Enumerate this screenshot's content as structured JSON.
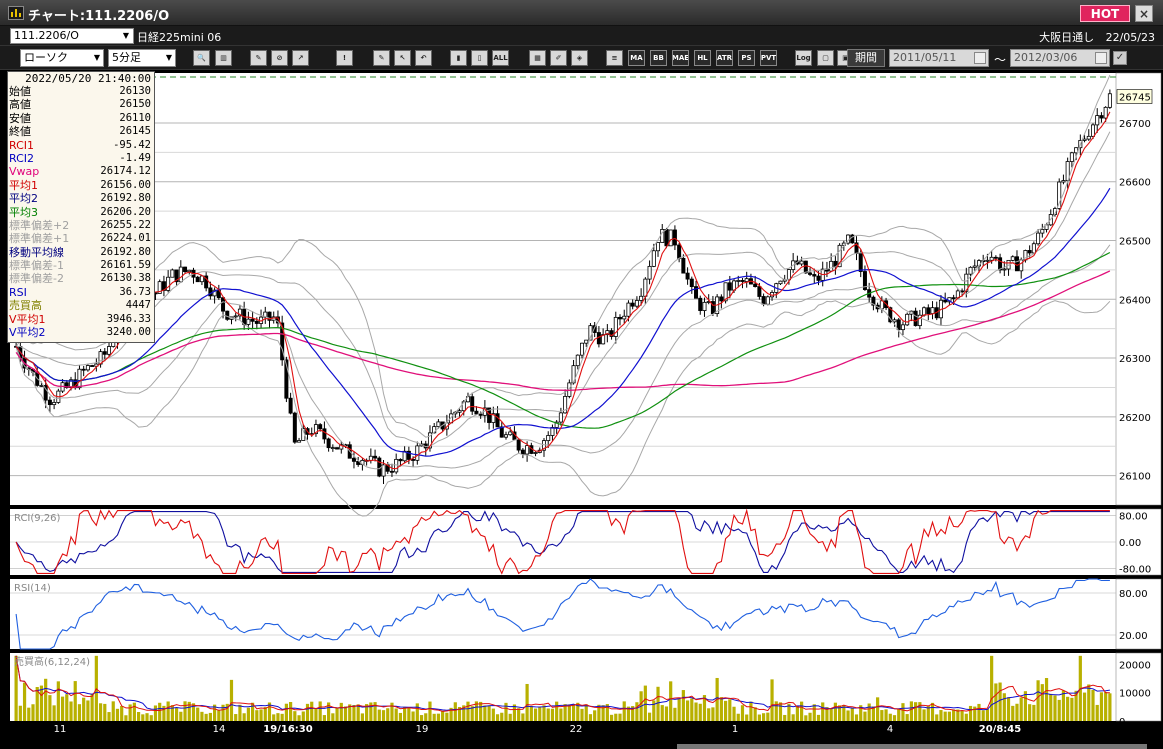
{
  "window": {
    "title": "チャート:111.2206/O",
    "hot_label": "HOT",
    "close_label": "×"
  },
  "symbol_bar": {
    "code": "111.2206/O",
    "name": "日経225mini 06",
    "exchange": "大阪日通し",
    "date": "22/05/23"
  },
  "toolbar": {
    "chart_type": "ローソク",
    "interval": "5分足",
    "period_label": "期間",
    "date_from": "2011/05/11",
    "date_sep": "〜",
    "date_to": "2012/03/06",
    "icons": [
      {
        "name": "magnify-icon",
        "glyph": "🔍"
      },
      {
        "name": "split-icon",
        "glyph": "▥"
      },
      {
        "name": "draw1-icon",
        "glyph": "✎"
      },
      {
        "name": "draw2-icon",
        "glyph": "⊘"
      },
      {
        "name": "draw3-icon",
        "glyph": "↗"
      },
      {
        "name": "alert-icon",
        "glyph": "!"
      },
      {
        "name": "pen-icon",
        "glyph": "✎"
      },
      {
        "name": "cursor-icon",
        "glyph": "↖"
      },
      {
        "name": "undo-icon",
        "glyph": "↶"
      },
      {
        "name": "candle1-icon",
        "glyph": "▮"
      },
      {
        "name": "candle2-icon",
        "glyph": "▯"
      },
      {
        "name": "all-icon",
        "glyph": "ALL"
      },
      {
        "name": "grid-icon",
        "glyph": "▦"
      },
      {
        "name": "brush-icon",
        "glyph": "✐"
      },
      {
        "name": "palette-icon",
        "glyph": "◈"
      },
      {
        "name": "indicator-icon",
        "glyph": "≡"
      },
      {
        "name": "ma-icon",
        "glyph": "MA"
      },
      {
        "name": "bb-icon",
        "glyph": "BB"
      },
      {
        "name": "mae-icon",
        "glyph": "MAE"
      },
      {
        "name": "hl-icon",
        "glyph": "HL"
      },
      {
        "name": "atr-icon",
        "glyph": "ATR"
      },
      {
        "name": "psar-icon",
        "glyph": "PS"
      },
      {
        "name": "pvt-icon",
        "glyph": "PVT"
      },
      {
        "name": "log-icon",
        "glyph": "Log"
      },
      {
        "name": "frame-icon",
        "glyph": "▢"
      },
      {
        "name": "export-icon",
        "glyph": "▣"
      }
    ]
  },
  "info_panel": {
    "timestamp": "2022/05/20 21:40:00",
    "rows": [
      {
        "label": "始値",
        "value": "26130",
        "color": "#000000"
      },
      {
        "label": "高値",
        "value": "26150",
        "color": "#000000"
      },
      {
        "label": "安値",
        "value": "26110",
        "color": "#000000"
      },
      {
        "label": "終値",
        "value": "26145",
        "color": "#000000"
      },
      {
        "label": "RCI1",
        "value": "-95.42",
        "color": "#d00000"
      },
      {
        "label": "RCI2",
        "value": "-1.49",
        "color": "#0000c0"
      },
      {
        "label": "Vwap",
        "value": "26174.12",
        "color": "#e0007a"
      },
      {
        "label": "平均1",
        "value": "26156.00",
        "color": "#d00000"
      },
      {
        "label": "平均2",
        "value": "26192.80",
        "color": "#000080"
      },
      {
        "label": "平均3",
        "value": "26206.20",
        "color": "#008000"
      },
      {
        "label": "標準偏差+2",
        "value": "26255.22",
        "color": "#a0a0a0"
      },
      {
        "label": "標準偏差+1",
        "value": "26224.01",
        "color": "#a0a0a0"
      },
      {
        "label": "移動平均線",
        "value": "26192.80",
        "color": "#000080"
      },
      {
        "label": "標準偏差-1",
        "value": "26161.59",
        "color": "#a0a0a0"
      },
      {
        "label": "標準偏差-2",
        "value": "26130.38",
        "color": "#a0a0a0"
      },
      {
        "label": "RSI",
        "value": "36.73",
        "color": "#0000c0"
      },
      {
        "label": "売買高",
        "value": "4447",
        "color": "#808000"
      },
      {
        "label": "V平均1",
        "value": "3946.33",
        "color": "#d00000"
      },
      {
        "label": "V平均2",
        "value": "3240.00",
        "color": "#0000c0"
      }
    ]
  },
  "colors": {
    "bg": "#000000",
    "panel": "#ffffff",
    "grid": "#b4b4b4",
    "ma1": "#e01010",
    "ma2": "#1010d0",
    "ma3": "#109010",
    "vwap": "#e0107a",
    "band": "#a8a8a8",
    "rci1": "#e01010",
    "rci2": "#1010a0",
    "rsi": "#2060e0",
    "volume": "#b8b000",
    "vavg1": "#e01010",
    "vavg2": "#1010d0",
    "current_price_bg": "#ffffe0",
    "line_dash": "#2a8a2a"
  },
  "chart_data": [
    {
      "type": "candlestick",
      "title": "",
      "y_ticks": [
        26100,
        26200,
        26300,
        26400,
        26500,
        26600,
        26700
      ],
      "ylim": [
        26050,
        26785
      ],
      "current_price": 26745,
      "x_labels": [
        "11",
        "14",
        "19/16:30",
        "19",
        "22",
        "1",
        "4",
        "20/8:45"
      ],
      "grid": true,
      "candles_close_path": [
        [
          0,
          26320
        ],
        [
          3,
          26270
        ],
        [
          6,
          26230
        ],
        [
          9,
          26250
        ],
        [
          12,
          26280
        ],
        [
          15,
          26300
        ],
        [
          18,
          26360
        ],
        [
          21,
          26420
        ],
        [
          24,
          26410
        ],
        [
          27,
          26440
        ],
        [
          30,
          26450
        ],
        [
          33,
          26430
        ],
        [
          36,
          26380
        ],
        [
          39,
          26370
        ],
        [
          42,
          26360
        ],
        [
          45,
          26370
        ],
        [
          48,
          26150
        ],
        [
          51,
          26180
        ],
        [
          54,
          26160
        ],
        [
          57,
          26140
        ],
        [
          60,
          26130
        ],
        [
          63,
          26110
        ],
        [
          66,
          26120
        ],
        [
          69,
          26140
        ],
        [
          72,
          26170
        ],
        [
          75,
          26200
        ],
        [
          78,
          26230
        ],
        [
          81,
          26210
        ],
        [
          84,
          26170
        ],
        [
          87,
          26150
        ],
        [
          90,
          26150
        ],
        [
          93,
          26180
        ],
        [
          96,
          26270
        ],
        [
          99,
          26350
        ],
        [
          102,
          26330
        ],
        [
          105,
          26380
        ],
        [
          108,
          26420
        ],
        [
          111,
          26510
        ],
        [
          114,
          26500
        ],
        [
          117,
          26400
        ],
        [
          120,
          26380
        ],
        [
          123,
          26420
        ],
        [
          126,
          26430
        ],
        [
          129,
          26400
        ],
        [
          132,
          26440
        ],
        [
          135,
          26460
        ],
        [
          138,
          26430
        ],
        [
          141,
          26460
        ],
        [
          144,
          26500
        ],
        [
          147,
          26420
        ],
        [
          150,
          26380
        ],
        [
          153,
          26360
        ],
        [
          156,
          26370
        ],
        [
          159,
          26380
        ],
        [
          162,
          26400
        ],
        [
          165,
          26450
        ],
        [
          168,
          26480
        ],
        [
          171,
          26450
        ],
        [
          174,
          26470
        ],
        [
          177,
          26510
        ],
        [
          180,
          26580
        ],
        [
          183,
          26650
        ],
        [
          186,
          26700
        ],
        [
          189,
          26745
        ]
      ]
    },
    {
      "type": "line",
      "title": "RCI(9,26)",
      "y_ticks": [
        80,
        0,
        -80
      ],
      "ylim": [
        -100,
        100
      ]
    },
    {
      "type": "line",
      "title": "RSI(14)",
      "y_ticks": [
        80,
        20
      ],
      "ylim": [
        0,
        100
      ]
    },
    {
      "type": "bar",
      "title": "売買高(6,12,24)",
      "y_ticks": [
        20000,
        10000,
        0
      ],
      "ylim": [
        0,
        24000
      ]
    }
  ]
}
